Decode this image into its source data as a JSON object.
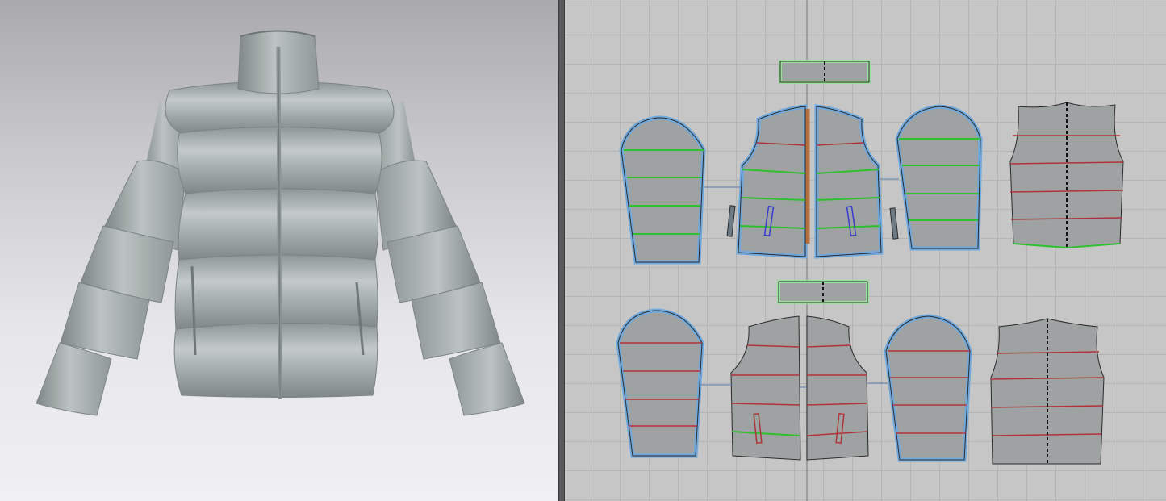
{
  "app": {
    "views": [
      "3D Garment Window",
      "2D Pattern Window"
    ]
  },
  "garment": {
    "type": "puffer jacket",
    "fabric_color": "#a3acab",
    "zipper_color": "#8b9493"
  },
  "pattern_window": {
    "background": "#c6c6c6",
    "grid_color": "#b4b4b4",
    "piece_fill": "#9fa2a3",
    "piece_outline": "#2b2b2b",
    "selected_outline_color": "#6fa8dc",
    "quilt_line_color_selected": "#2ec02e",
    "quilt_line_color": "#b0333a",
    "piece_count": 14,
    "pieces": [
      "collar-top",
      "sleeve-left-top",
      "front-left-top",
      "front-right-top",
      "sleeve-right-top",
      "back-top",
      "collar-bottom",
      "sleeve-left-bottom",
      "front-left-bottom",
      "front-right-bottom",
      "sleeve-right-bottom",
      "back-bottom"
    ]
  }
}
